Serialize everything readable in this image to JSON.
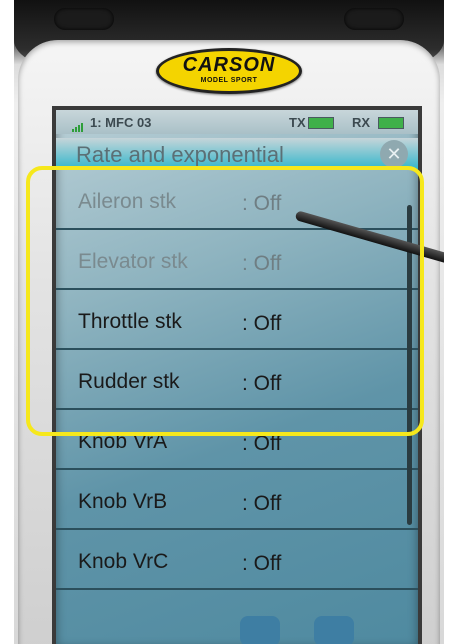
{
  "brand": {
    "name": "CARSON",
    "tagline": "MODEL SPORT"
  },
  "status_bar": {
    "model_label": "1: MFC 03",
    "tx_label": "TX",
    "rx_label": "RX"
  },
  "screen": {
    "title": "Rate and exponential"
  },
  "items": [
    {
      "label": "Aileron stk",
      "value": ": Off"
    },
    {
      "label": "Elevator stk",
      "value": ": Off"
    },
    {
      "label": "Throttle stk",
      "value": ": Off"
    },
    {
      "label": "Rudder stk",
      "value": ": Off"
    },
    {
      "label": "Knob VrA",
      "value": ": Off"
    },
    {
      "label": "Knob VrB",
      "value": ": Off"
    },
    {
      "label": "Knob VrC",
      "value": ": Off"
    }
  ],
  "colors": {
    "highlight": "#f6e81c",
    "battery": "#3fb04a",
    "logo": "#f4d400"
  },
  "icons": {
    "close": "close-icon",
    "signal": "signal-bars-icon",
    "battery": "battery-icon"
  }
}
